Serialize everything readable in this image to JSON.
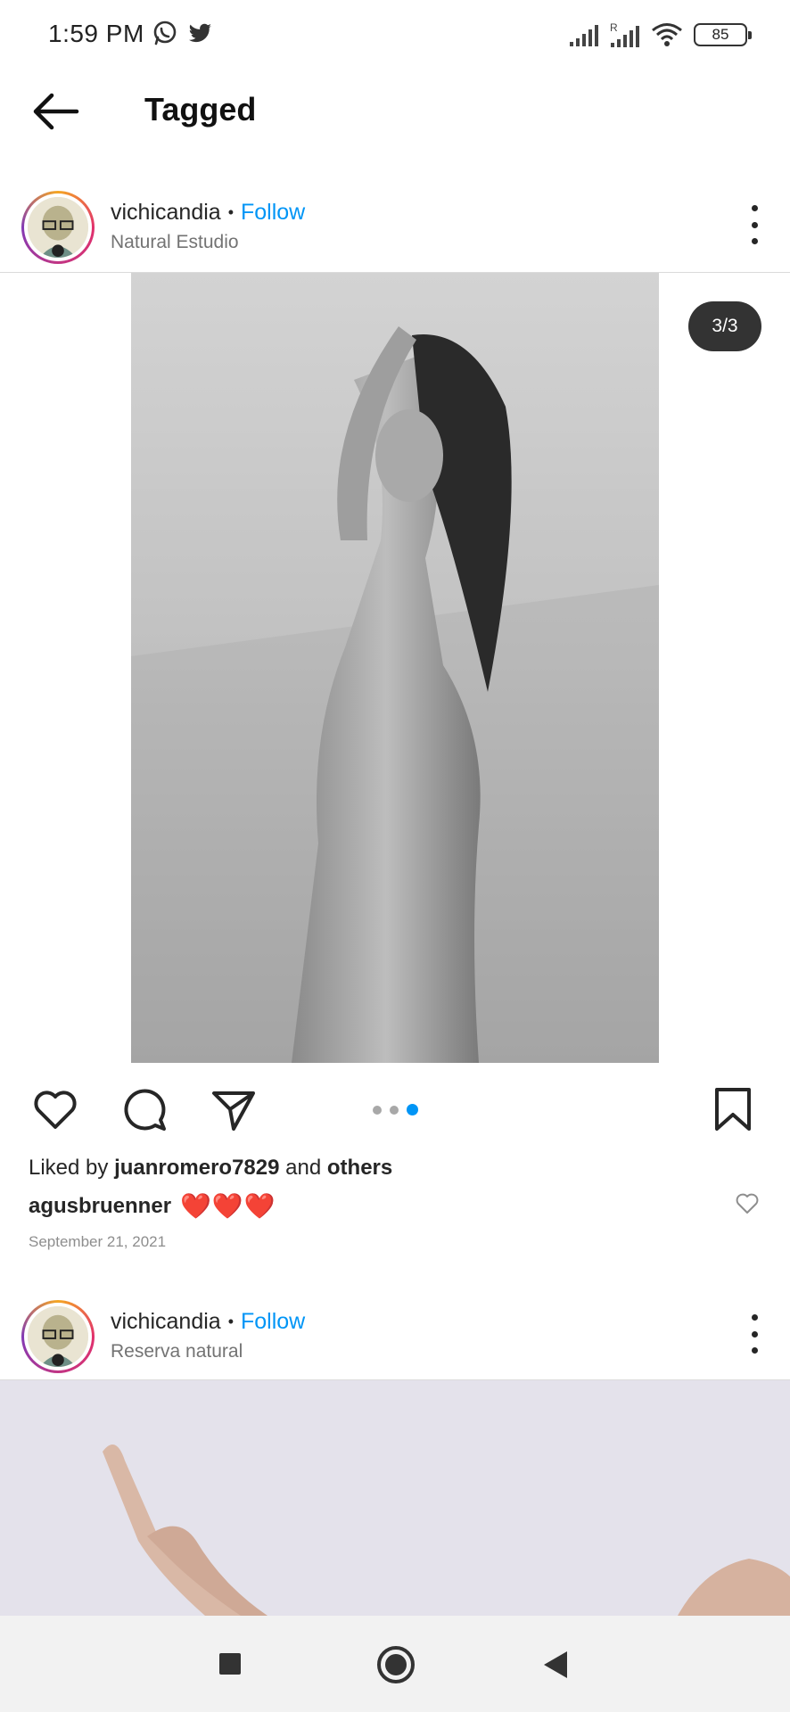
{
  "status_bar": {
    "time": "1:59 PM",
    "battery": "85",
    "icons": [
      "whatsapp-icon",
      "twitter-icon",
      "signal-icon",
      "signal-roaming-icon",
      "wifi-icon",
      "battery-icon"
    ]
  },
  "header": {
    "title": "Tagged",
    "back_icon": "arrow-left-icon"
  },
  "posts": [
    {
      "username": "vichicandia",
      "separator": "•",
      "follow_label": "Follow",
      "location": "Natural Estudio",
      "carousel_counter": "3/3",
      "carousel_total": 3,
      "carousel_active": 3,
      "likes_prefix": "Liked by ",
      "likes_user": "juanromero7829",
      "likes_middle": " and ",
      "likes_others": "others",
      "caption_user": "agusbruenner",
      "caption_text": "❤️❤️❤️",
      "date": "September 21, 2021"
    },
    {
      "username": "vichicandia",
      "separator": "•",
      "follow_label": "Follow",
      "location": "Reserva natural"
    }
  ],
  "colors": {
    "accent": "#0095f6",
    "text": "#262626",
    "secondary_text": "#737373",
    "heart": "#e0245e"
  }
}
